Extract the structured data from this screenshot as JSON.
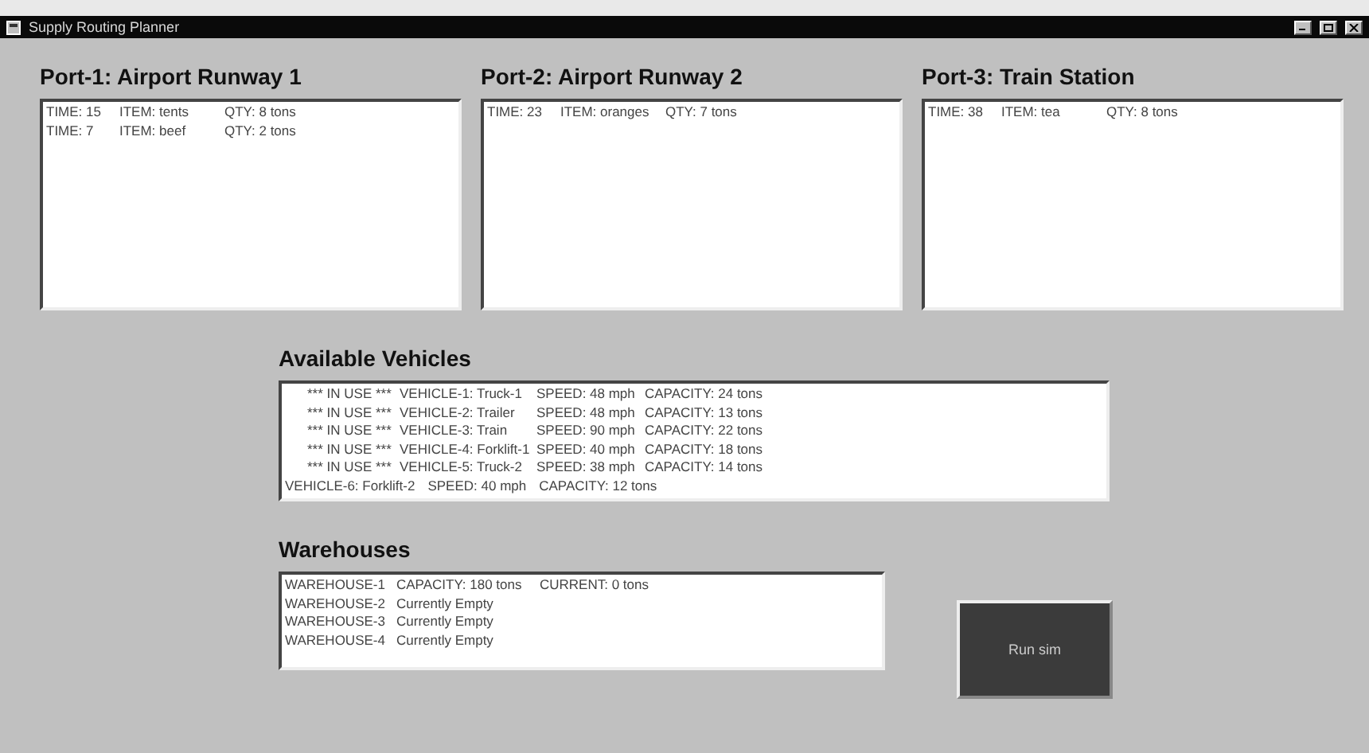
{
  "window": {
    "title": "Supply Routing Planner"
  },
  "ports": [
    {
      "title": "Port-1: Airport Runway 1",
      "rows": [
        {
          "time": "TIME: 15",
          "item": "ITEM: tents",
          "qty": "QTY: 8 tons"
        },
        {
          "time": "TIME: 7",
          "item": "ITEM: beef",
          "qty": "QTY: 2 tons"
        }
      ]
    },
    {
      "title": "Port-2: Airport Runway 2",
      "rows": [
        {
          "time": "TIME: 23",
          "item": "ITEM: oranges",
          "qty": "QTY: 7 tons"
        }
      ]
    },
    {
      "title": "Port-3: Train Station",
      "rows": [
        {
          "time": "TIME: 38",
          "item": "ITEM: tea",
          "qty": "QTY: 8 tons"
        }
      ]
    }
  ],
  "vehicles": {
    "title": "Available Vehicles",
    "rows": [
      {
        "status": "*** IN USE ***",
        "vehicle": "VEHICLE-1: Truck-1",
        "speed": "SPEED: 48 mph",
        "capacity": "CAPACITY: 24 tons"
      },
      {
        "status": "*** IN USE ***",
        "vehicle": "VEHICLE-2: Trailer",
        "speed": "SPEED: 48 mph",
        "capacity": "CAPACITY: 13 tons"
      },
      {
        "status": "*** IN USE ***",
        "vehicle": "VEHICLE-3: Train",
        "speed": "SPEED: 90 mph",
        "capacity": "CAPACITY: 22 tons"
      },
      {
        "status": "*** IN USE ***",
        "vehicle": "VEHICLE-4: Forklift-1",
        "speed": "SPEED: 40 mph",
        "capacity": "CAPACITY: 18 tons"
      },
      {
        "status": "*** IN USE ***",
        "vehicle": "VEHICLE-5: Truck-2",
        "speed": "SPEED: 38 mph",
        "capacity": "CAPACITY: 14 tons"
      },
      {
        "vehicle": "VEHICLE-6: Forklift-2",
        "speed": "SPEED: 40 mph",
        "capacity": "CAPACITY: 12 tons"
      }
    ]
  },
  "warehouses": {
    "title": "Warehouses",
    "rows": [
      {
        "name": "WAREHOUSE-1",
        "info": [
          "CAPACITY: 180 tons",
          "CURRENT: 0 tons"
        ]
      },
      {
        "name": "WAREHOUSE-2",
        "info": [
          "Currently Empty"
        ]
      },
      {
        "name": "WAREHOUSE-3",
        "info": [
          "Currently Empty"
        ]
      },
      {
        "name": "WAREHOUSE-4",
        "info": [
          "Currently Empty"
        ]
      }
    ]
  },
  "button": "Run sim"
}
